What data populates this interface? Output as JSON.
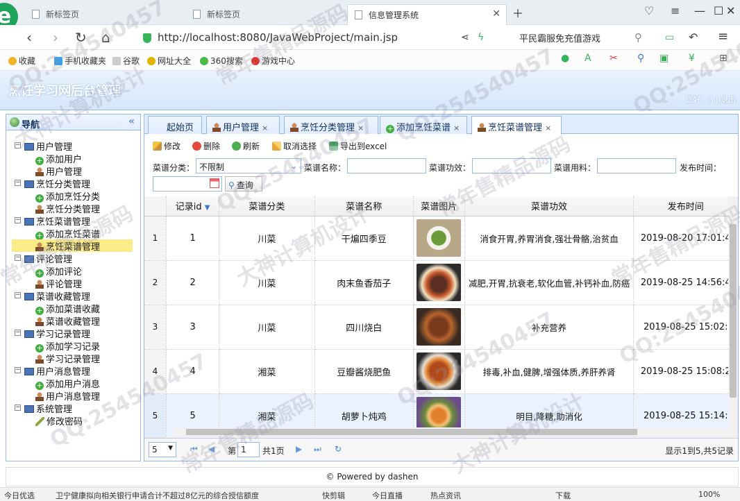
{
  "browser": {
    "tabs": [
      {
        "label": "新标签页"
      },
      {
        "label": "新标签页"
      },
      {
        "label": "信息管理系统"
      }
    ],
    "url": "http://localhost:8080/JavaWebProject/main.jsp",
    "search_text": "平民霸服免充值游戏",
    "bookmarks": [
      "收藏",
      "手机收藏夹",
      "谷歌",
      "网址大全",
      "360搜索",
      "游戏中心"
    ]
  },
  "app": {
    "title": "烹饪学习网后台管理",
    "user_links": "您好，a | 退出"
  },
  "nav": {
    "title": "导航",
    "tree": [
      {
        "label": "用户管理",
        "type": "group"
      },
      {
        "label": "添加用户",
        "type": "add"
      },
      {
        "label": "用户管理",
        "type": "user"
      },
      {
        "label": "烹饪分类管理",
        "type": "group"
      },
      {
        "label": "添加烹饪分类",
        "type": "add"
      },
      {
        "label": "烹饪分类管理",
        "type": "user"
      },
      {
        "label": "烹饪菜谱管理",
        "type": "group"
      },
      {
        "label": "添加烹饪菜谱",
        "type": "add"
      },
      {
        "label": "烹饪菜谱管理",
        "type": "user"
      },
      {
        "label": "评论管理",
        "type": "group"
      },
      {
        "label": "添加评论",
        "type": "add"
      },
      {
        "label": "评论管理",
        "type": "user"
      },
      {
        "label": "菜谱收藏管理",
        "type": "group"
      },
      {
        "label": "添加菜谱收藏",
        "type": "add"
      },
      {
        "label": "菜谱收藏管理",
        "type": "user"
      },
      {
        "label": "学习记录管理",
        "type": "group"
      },
      {
        "label": "添加学习记录",
        "type": "add"
      },
      {
        "label": "学习记录管理",
        "type": "user"
      },
      {
        "label": "用户消息管理",
        "type": "group"
      },
      {
        "label": "添加用户消息",
        "type": "add"
      },
      {
        "label": "用户消息管理",
        "type": "user"
      },
      {
        "label": "系统管理",
        "type": "group"
      },
      {
        "label": "修改密码",
        "type": "pencil"
      }
    ]
  },
  "main_tabs": [
    {
      "label": "起始页",
      "closable": false
    },
    {
      "label": "用户管理",
      "closable": true
    },
    {
      "label": "烹饪分类管理",
      "closable": true
    },
    {
      "label": "添加烹饪菜谱",
      "closable": true
    },
    {
      "label": "烹饪菜谱管理",
      "closable": true
    }
  ],
  "toolbar": {
    "edit": "修改",
    "delete": "删除",
    "refresh": "刷新",
    "cancel_select": "取消选择",
    "export": "导出到excel"
  },
  "filters": {
    "category_label": "菜谱分类：",
    "category_value": "不限制",
    "name_label": "菜谱名称：",
    "effect_label": "菜谱功效：",
    "ingredient_label": "菜谱用料：",
    "publish_label": "发布时间：",
    "query_button": "查询"
  },
  "grid": {
    "columns": [
      "记录id",
      "菜谱分类",
      "菜谱名称",
      "菜谱图片",
      "菜谱功效",
      "发布时间"
    ],
    "rows": [
      {
        "rownum": "1",
        "id": "1",
        "category": "川菜",
        "name": "干煸四季豆",
        "effect": "消食开胃,养胃消食,强壮骨骼,治贫血",
        "time": "2019-08-20 17:01:4",
        "img": "green-beans"
      },
      {
        "rownum": "2",
        "id": "2",
        "category": "川菜",
        "name": "肉末鱼香茄子",
        "effect": "减肥,开胃,抗衰老,软化血管,补钙补血,防癌",
        "time": "2019-08-25 14:56:4",
        "img": "eggplant"
      },
      {
        "rownum": "3",
        "id": "3",
        "category": "川菜",
        "name": "四川烧白",
        "effect": "补充营养",
        "time": "2019-08-25 15:02:",
        "img": "pork"
      },
      {
        "rownum": "4",
        "id": "4",
        "category": "湘菜",
        "name": "豆瓣酱烧肥鱼",
        "effect": "排毒,补血,健脾,增强体质,养肝养肾",
        "time": "2019-08-25 15:08:2",
        "img": "fish"
      },
      {
        "rownum": "5",
        "id": "5",
        "category": "湘菜",
        "name": "胡萝卜炖鸡",
        "effect": "明目,降糖,助消化",
        "time": "2019-08-25 15:14:",
        "img": "chicken"
      }
    ]
  },
  "pager": {
    "page_size": "5",
    "page_label": "第",
    "page_value": "1",
    "total_pages": "共1页",
    "summary": "显示1到5,共5记录"
  },
  "footer": "© Powered by dashen",
  "statusbar": {
    "left": "今日优选",
    "news": "卫宁健康拟向相关银行申请合计不超过8亿元的综合授信额度",
    "items": [
      "快剪辑",
      "今日直播",
      "热点资讯",
      "下载",
      "100%"
    ]
  },
  "watermarks": [
    "QQ:254540457",
    "常年售精品源码",
    "大神计算机设计"
  ]
}
